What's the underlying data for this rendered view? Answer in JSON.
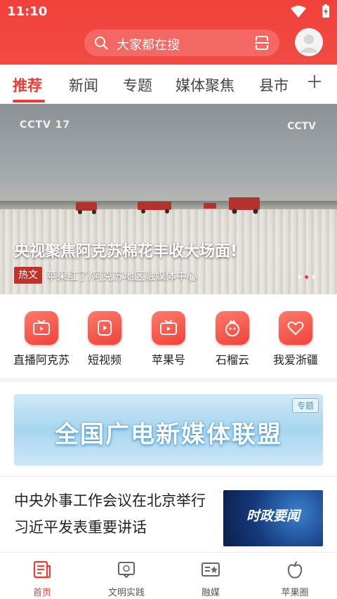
{
  "status": {
    "time": "11:10"
  },
  "header": {
    "search_placeholder": "大家都在搜"
  },
  "tabs": [
    {
      "label": "推荐",
      "active": true
    },
    {
      "label": "新闻",
      "active": false
    },
    {
      "label": "专题",
      "active": false
    },
    {
      "label": "媒体聚焦",
      "active": false
    },
    {
      "label": "县市",
      "active": false
    }
  ],
  "hero": {
    "logo_left": "CCTV 17",
    "logo_right": "CCTV",
    "headline": "央视聚焦阿克苏棉花丰收大场面!",
    "badge": "热文",
    "caption": "苹果红了/阿克苏地区融媒体中心",
    "slide_index": 2,
    "slide_count": 3
  },
  "quick_links": [
    {
      "label": "直播阿克苏",
      "icon": "live-tv-icon"
    },
    {
      "label": "短视频",
      "icon": "short-video-icon"
    },
    {
      "label": "苹果号",
      "icon": "apple-tv-icon"
    },
    {
      "label": "石榴云",
      "icon": "pomegranate-icon"
    },
    {
      "label": "我爱浙疆",
      "icon": "heart-icon"
    }
  ],
  "banner": {
    "text": "全国广电新媒体联盟",
    "tag": "专题"
  },
  "news": [
    {
      "title": "中央外事工作会议在北京举行 习近平发表重要讲话",
      "thumb_title": "时政要闻"
    }
  ],
  "bottom_nav": [
    {
      "label": "首页",
      "icon": "home-news-icon",
      "active": true
    },
    {
      "label": "文明实践",
      "icon": "civilization-icon",
      "active": false
    },
    {
      "label": "融媒",
      "icon": "media-icon",
      "active": false
    },
    {
      "label": "苹果圈",
      "icon": "apple-icon",
      "active": false
    }
  ],
  "colors": {
    "brand_red": "#ee3b34",
    "header_red": "#f2413b"
  }
}
